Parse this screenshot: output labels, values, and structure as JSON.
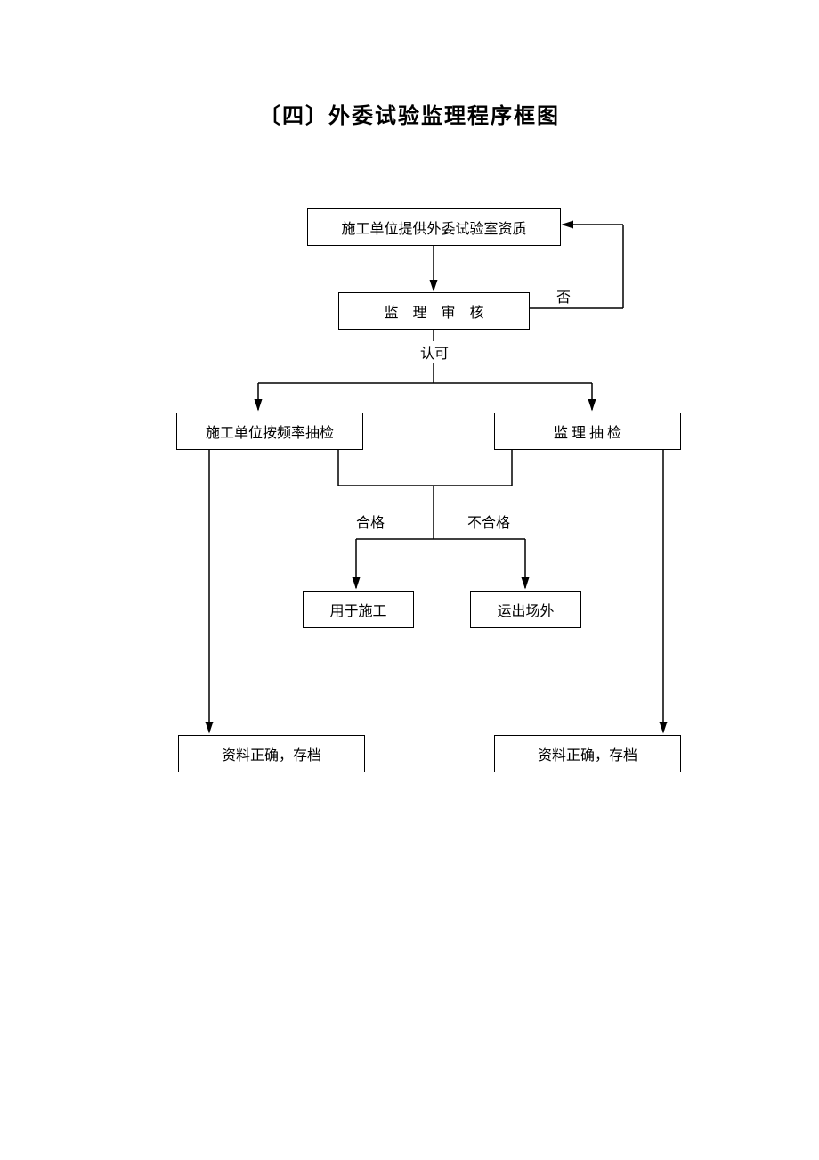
{
  "title": "〔四〕外委试验监理程序框图",
  "nodes": {
    "n1": "施工单位提供外委试验室资质",
    "n2": "监　理　审　核",
    "n3": "施工单位按频率抽检",
    "n4": "监 理 抽 检",
    "n5": "用于施工",
    "n6": "运出场外",
    "n7": "资料正确，存档",
    "n8": "资料正确，存档"
  },
  "labels": {
    "no": "否",
    "approve": "认可",
    "pass": "合格",
    "fail": "不合格"
  }
}
